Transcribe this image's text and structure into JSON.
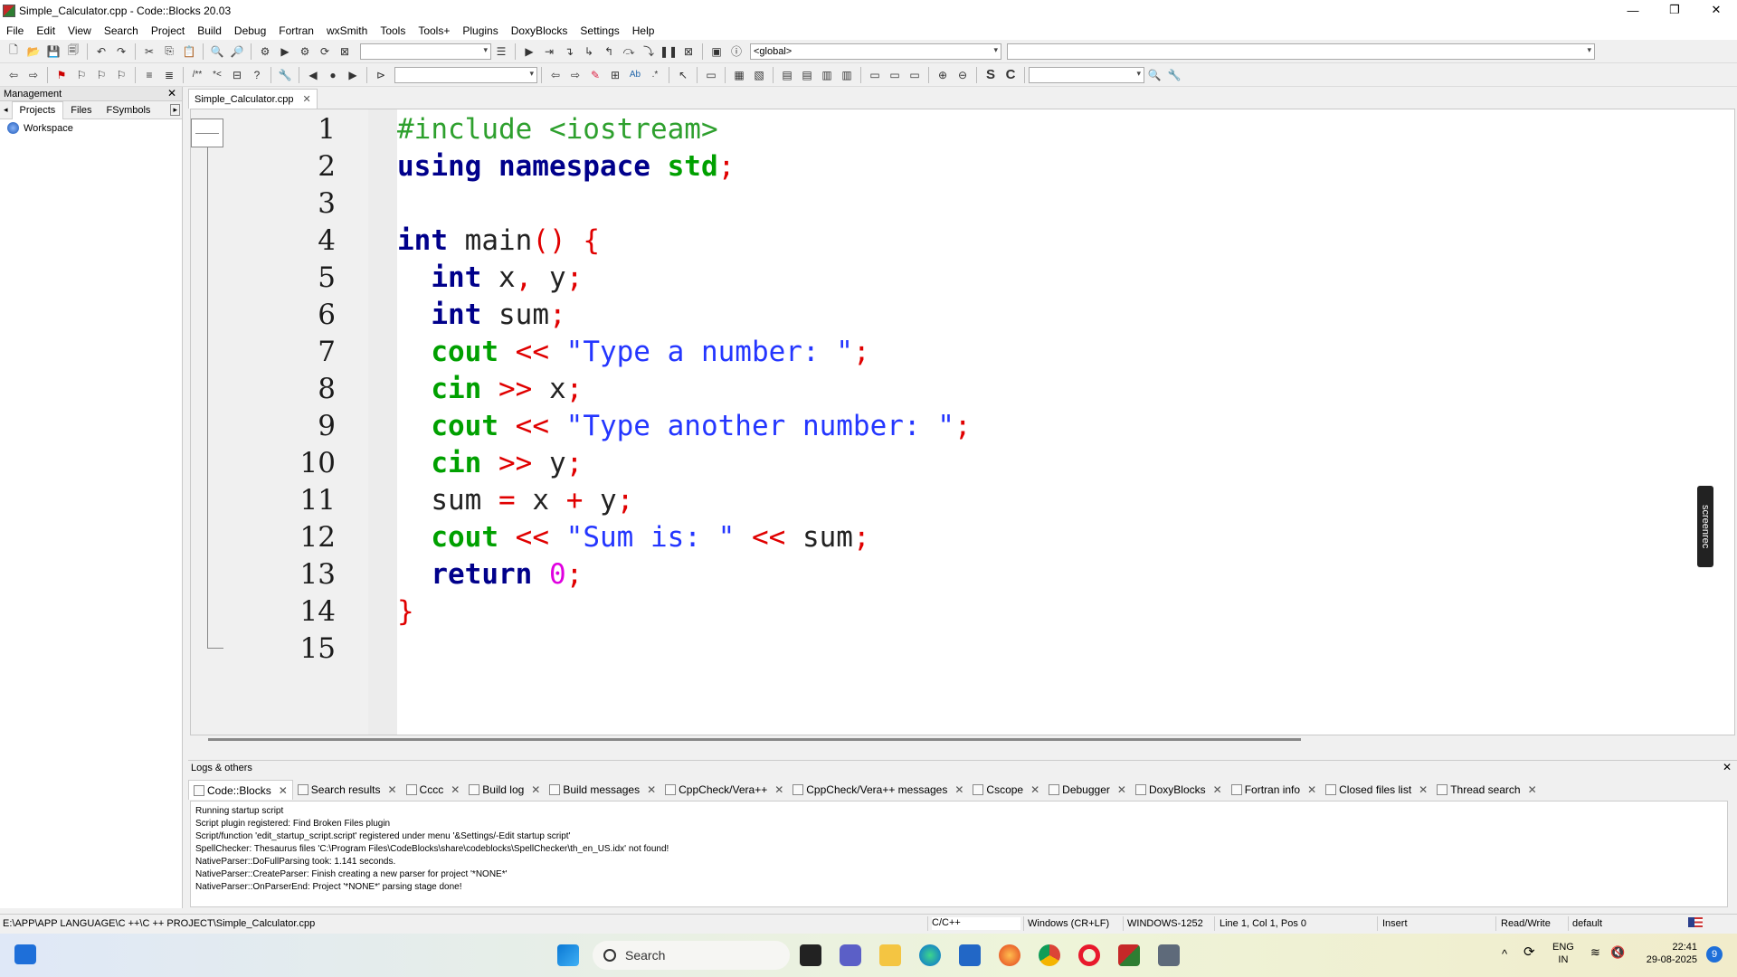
{
  "window": {
    "title": "Simple_Calculator.cpp - Code::Blocks 20.03",
    "minimize": "—",
    "maximize": "❐",
    "close": "✕"
  },
  "menu": [
    "File",
    "Edit",
    "View",
    "Search",
    "Project",
    "Build",
    "Debug",
    "Fortran",
    "wxSmith",
    "Tools",
    "Tools+",
    "Plugins",
    "DoxyBlocks",
    "Settings",
    "Help"
  ],
  "toolbar": {
    "scope_combo": "<global>",
    "symbol_combo": "",
    "search_combo": ""
  },
  "management": {
    "title": "Management",
    "tabs": [
      "Projects",
      "Files",
      "FSymbols"
    ],
    "workspace": "Workspace"
  },
  "editor": {
    "tab": "Simple_Calculator.cpp",
    "line_numbers": [
      "1",
      "2",
      "3",
      "4",
      "5",
      "6",
      "7",
      "8",
      "9",
      "10",
      "11",
      "12",
      "13",
      "14",
      "15"
    ]
  },
  "logs": {
    "title": "Logs & others",
    "tabs": [
      "Code::Blocks",
      "Search results",
      "Cccc",
      "Build log",
      "Build messages",
      "CppCheck/Vera++",
      "CppCheck/Vera++ messages",
      "Cscope",
      "Debugger",
      "DoxyBlocks",
      "Fortran info",
      "Closed files list",
      "Thread search"
    ],
    "lines": [
      "Running startup script",
      "Script plugin registered: Find Broken Files plugin",
      "Script/function 'edit_startup_script.script' registered under menu '&Settings/-Edit startup script'",
      "SpellChecker: Thesaurus files 'C:\\Program Files\\CodeBlocks\\share\\codeblocks\\SpellChecker\\th_en_US.idx' not found!",
      "NativeParser::DoFullParsing took: 1.141 seconds.",
      "NativeParser::CreateParser: Finish creating a new parser for project '*NONE*'",
      "NativeParser::OnParserEnd: Project '*NONE*' parsing stage done!"
    ]
  },
  "status": {
    "path": "E:\\APP\\APP LANGUAGE\\C ++\\C ++ PROJECT\\Simple_Calculator.cpp",
    "language": "C/C++",
    "eol": "Windows (CR+LF)",
    "encoding": "WINDOWS-1252",
    "position": "Line 1, Col 1, Pos 0",
    "mode": "Insert",
    "access": "Read/Write",
    "profile": "default"
  },
  "taskbar": {
    "search": "Search",
    "lang": "ENG",
    "region": "IN",
    "time": "22:41",
    "date": "29-08-2025",
    "badge": "9"
  },
  "overlay": {
    "screenrec": "screenrec"
  }
}
